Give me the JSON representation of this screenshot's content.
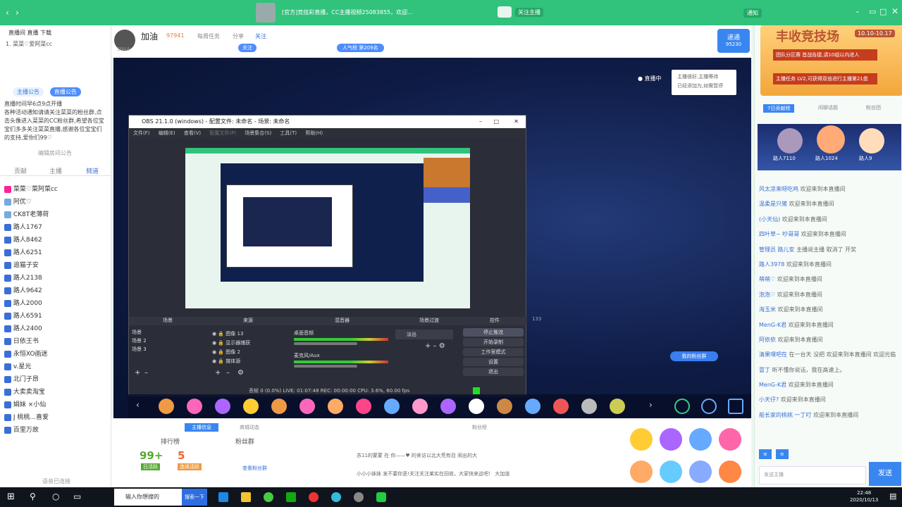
{
  "topbar": {
    "title": "[官方]竞技彩直播，CC主播视频25083855，欢迎...",
    "fans": "关注主播",
    "notice": "通知"
  },
  "left": {
    "streamer": "直播间 直播 下载",
    "sub": "1. 菜菜♡爱阿菜cc",
    "tabs": [
      "主播公告",
      "直播公告"
    ],
    "announce": [
      "直播时间早6点9点开播",
      "各种活动通知请请关注菜菜的粉丝群,点击头像进入菜菜的CC粉丝群,希望各位宝宝们多多关注菜菜直播,感谢各位宝宝们的支持,爱你们99♡"
    ],
    "edit": "编辑房间公告",
    "subtabs": [
      "贡献",
      "主播",
      "频道"
    ],
    "list": [
      "菜菜♡菜阿菜cc",
      "阿优♡",
      "CK8T老薄荷",
      "路人1767",
      "路人8462",
      "路人6251",
      "追猫子安",
      "路人2138",
      "路人9642",
      "路人2000",
      "路人6591",
      "路人2400",
      "日依王书",
      "永恒XO画迷",
      "v.星光",
      "北门子昂",
      "大卖卖淘宝",
      "娟妹 ×小仙",
      "J 桃桃...喜爱",
      "百里万故"
    ],
    "footer": "语音已连接"
  },
  "header": {
    "name": "加油",
    "id": "3944",
    "level": "97941",
    "tags": [
      "每周任务",
      "分享",
      "关注"
    ],
    "follow": "关注",
    "rank": "人气榜 第209名",
    "orig": "递通",
    "origsub": "95230"
  },
  "video": {
    "badge": "直播中",
    "tip1": "主播很好,主播等待",
    "tip2": "已经添加为,如需暂停",
    "btn": "我的粉丝群",
    "code": "133"
  },
  "obs": {
    "title": "OBS 21.1.0 (windows) - 配置文件: 未命名 - 场景: 未命名",
    "menu": [
      "文件(F)",
      "编辑(E)",
      "查看(V)",
      "配置文件(P)",
      "场景集合(S)",
      "工具(T)",
      "帮助(H)"
    ],
    "panels": [
      "场景",
      "来源",
      "混音器",
      "场景过渡",
      "控件"
    ],
    "scenes": [
      "场景",
      "场景 2",
      "场景 3"
    ],
    "sources": [
      "图像 13",
      "显示器捕获",
      "图像 2",
      "媒体源"
    ],
    "mixer": [
      "桌面音频",
      "麦克风/Aux"
    ],
    "trans": "淡出",
    "controls": [
      "停止推流",
      "开始录制",
      "工作室模式",
      "设置",
      "退出"
    ],
    "status": "丢帧 0 (0.0%)   LIVE: 01:07:48   REC: 00:00:00   CPU: 3.6%, 60.00 fps"
  },
  "below": {
    "tabs": [
      "主播信息",
      "商城动态",
      "粉丝榜"
    ],
    "rank": "排行榜",
    "fans": "粉丝群",
    "num1": "99+",
    "num1sub": "日活跃",
    "num2": "5",
    "num2sub": "连续活跃",
    "link": "查看粉丝群",
    "chat": [
      "苏11的蒙蒙 在 你——♥ 的来访以北大荒有目 闹出的大",
      "小小小妹妹 发不要你恶!关注关注某实在回收，大家快来这吧！ 大加道"
    ]
  },
  "right": {
    "banner": "丰收竞技场",
    "date": "10.10-10.17",
    "tasks": [
      "团队分区赛 首战告捷,请10组以内进人",
      "主播任务 LV2,可获得双倍进行主播第21盘"
    ],
    "tabs": [
      "7日贡献榜",
      "闲聊话题",
      "粉丝团"
    ],
    "top": [
      "路人7110",
      "路人1024",
      "路人9"
    ],
    "chat": [
      [
        "风太凉来呀吃鸡",
        "欢迎来到本直播间"
      ],
      [
        "温柔是只猪",
        "欢迎来到本直播间"
      ],
      [
        "(小天仙)",
        "欢迎来到本直播间"
      ],
      [
        "四叶草~ 吵哥哥",
        "欢迎来到本直播间"
      ],
      [
        "管理员 路儿安",
        "主播说主播 取消了 开奖"
      ],
      [
        "路人3978",
        "欢迎来到本直播间"
      ],
      [
        "萌萌♡",
        "欢迎来到本直播间"
      ],
      [
        "泡泡♡",
        "欢迎来到本直播间"
      ],
      [
        "海玉米",
        "欢迎来到本直播间"
      ],
      [
        "MenG-K君",
        "欢迎来到本直播间"
      ],
      [
        "阿依依",
        "欢迎来到本直播间"
      ],
      [
        "清果嘿吧在",
        "在一台天 没把 欢迎来到本直播间 欢迎光临"
      ],
      [
        "冒丁",
        "听不懂你说话，我在高速上。"
      ],
      [
        "MenG-K君",
        "欢迎来到本直播间"
      ],
      [
        "小天仔?",
        "欢迎来到本直播间"
      ],
      [
        "船长家的桃桃 一丁叮",
        "欢迎来到本直播间"
      ]
    ],
    "input": "发送主播",
    "send": "发送"
  },
  "taskbar": {
    "search": "输入你想搜的",
    "time": "22:48",
    "date": "2020/10/13",
    "btn": "搜索一下"
  }
}
